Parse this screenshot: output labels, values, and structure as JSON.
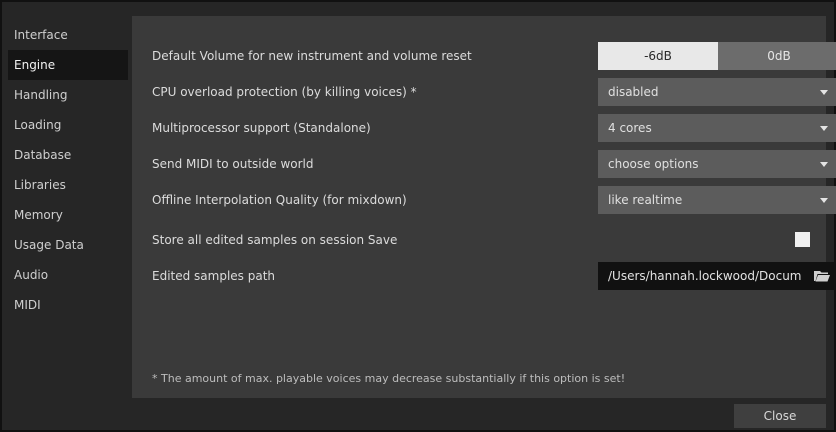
{
  "sidebar": {
    "items": [
      {
        "label": "Interface"
      },
      {
        "label": "Engine"
      },
      {
        "label": "Handling"
      },
      {
        "label": "Loading"
      },
      {
        "label": "Database"
      },
      {
        "label": "Libraries"
      },
      {
        "label": "Memory"
      },
      {
        "label": "Usage Data"
      },
      {
        "label": "Audio"
      },
      {
        "label": "MIDI"
      }
    ],
    "selected": "Engine"
  },
  "settings": {
    "default_volume": {
      "label": "Default Volume for new instrument and volume reset",
      "options": [
        "-6dB",
        "0dB"
      ],
      "selected": "-6dB"
    },
    "cpu_overload": {
      "label": "CPU overload protection (by killing voices) *",
      "value": "disabled"
    },
    "multiprocessor": {
      "label": "Multiprocessor support  (Standalone)",
      "value": "4 cores"
    },
    "send_midi": {
      "label": "Send MIDI to outside world",
      "value": "choose options"
    },
    "offline_interpolation": {
      "label": "Offline Interpolation Quality (for mixdown)",
      "value": "like realtime"
    },
    "store_samples": {
      "label": "Store all edited samples on session Save",
      "checked": false
    },
    "edited_path": {
      "label": "Edited samples path",
      "value": "/Users/hannah.lockwood/Docum"
    }
  },
  "footnote": "* The amount of max. playable voices may decrease substantially if this option is set!",
  "buttons": {
    "close": "Close"
  },
  "icons": {
    "dropdown": "chevron-down-icon",
    "folder": "folder-icon"
  },
  "colors": {
    "panel": "#3a3a3a",
    "sidebar_active": "#151515",
    "segment_selected": "#e8e8e8",
    "dropdown_bg": "#5c5c5c"
  }
}
